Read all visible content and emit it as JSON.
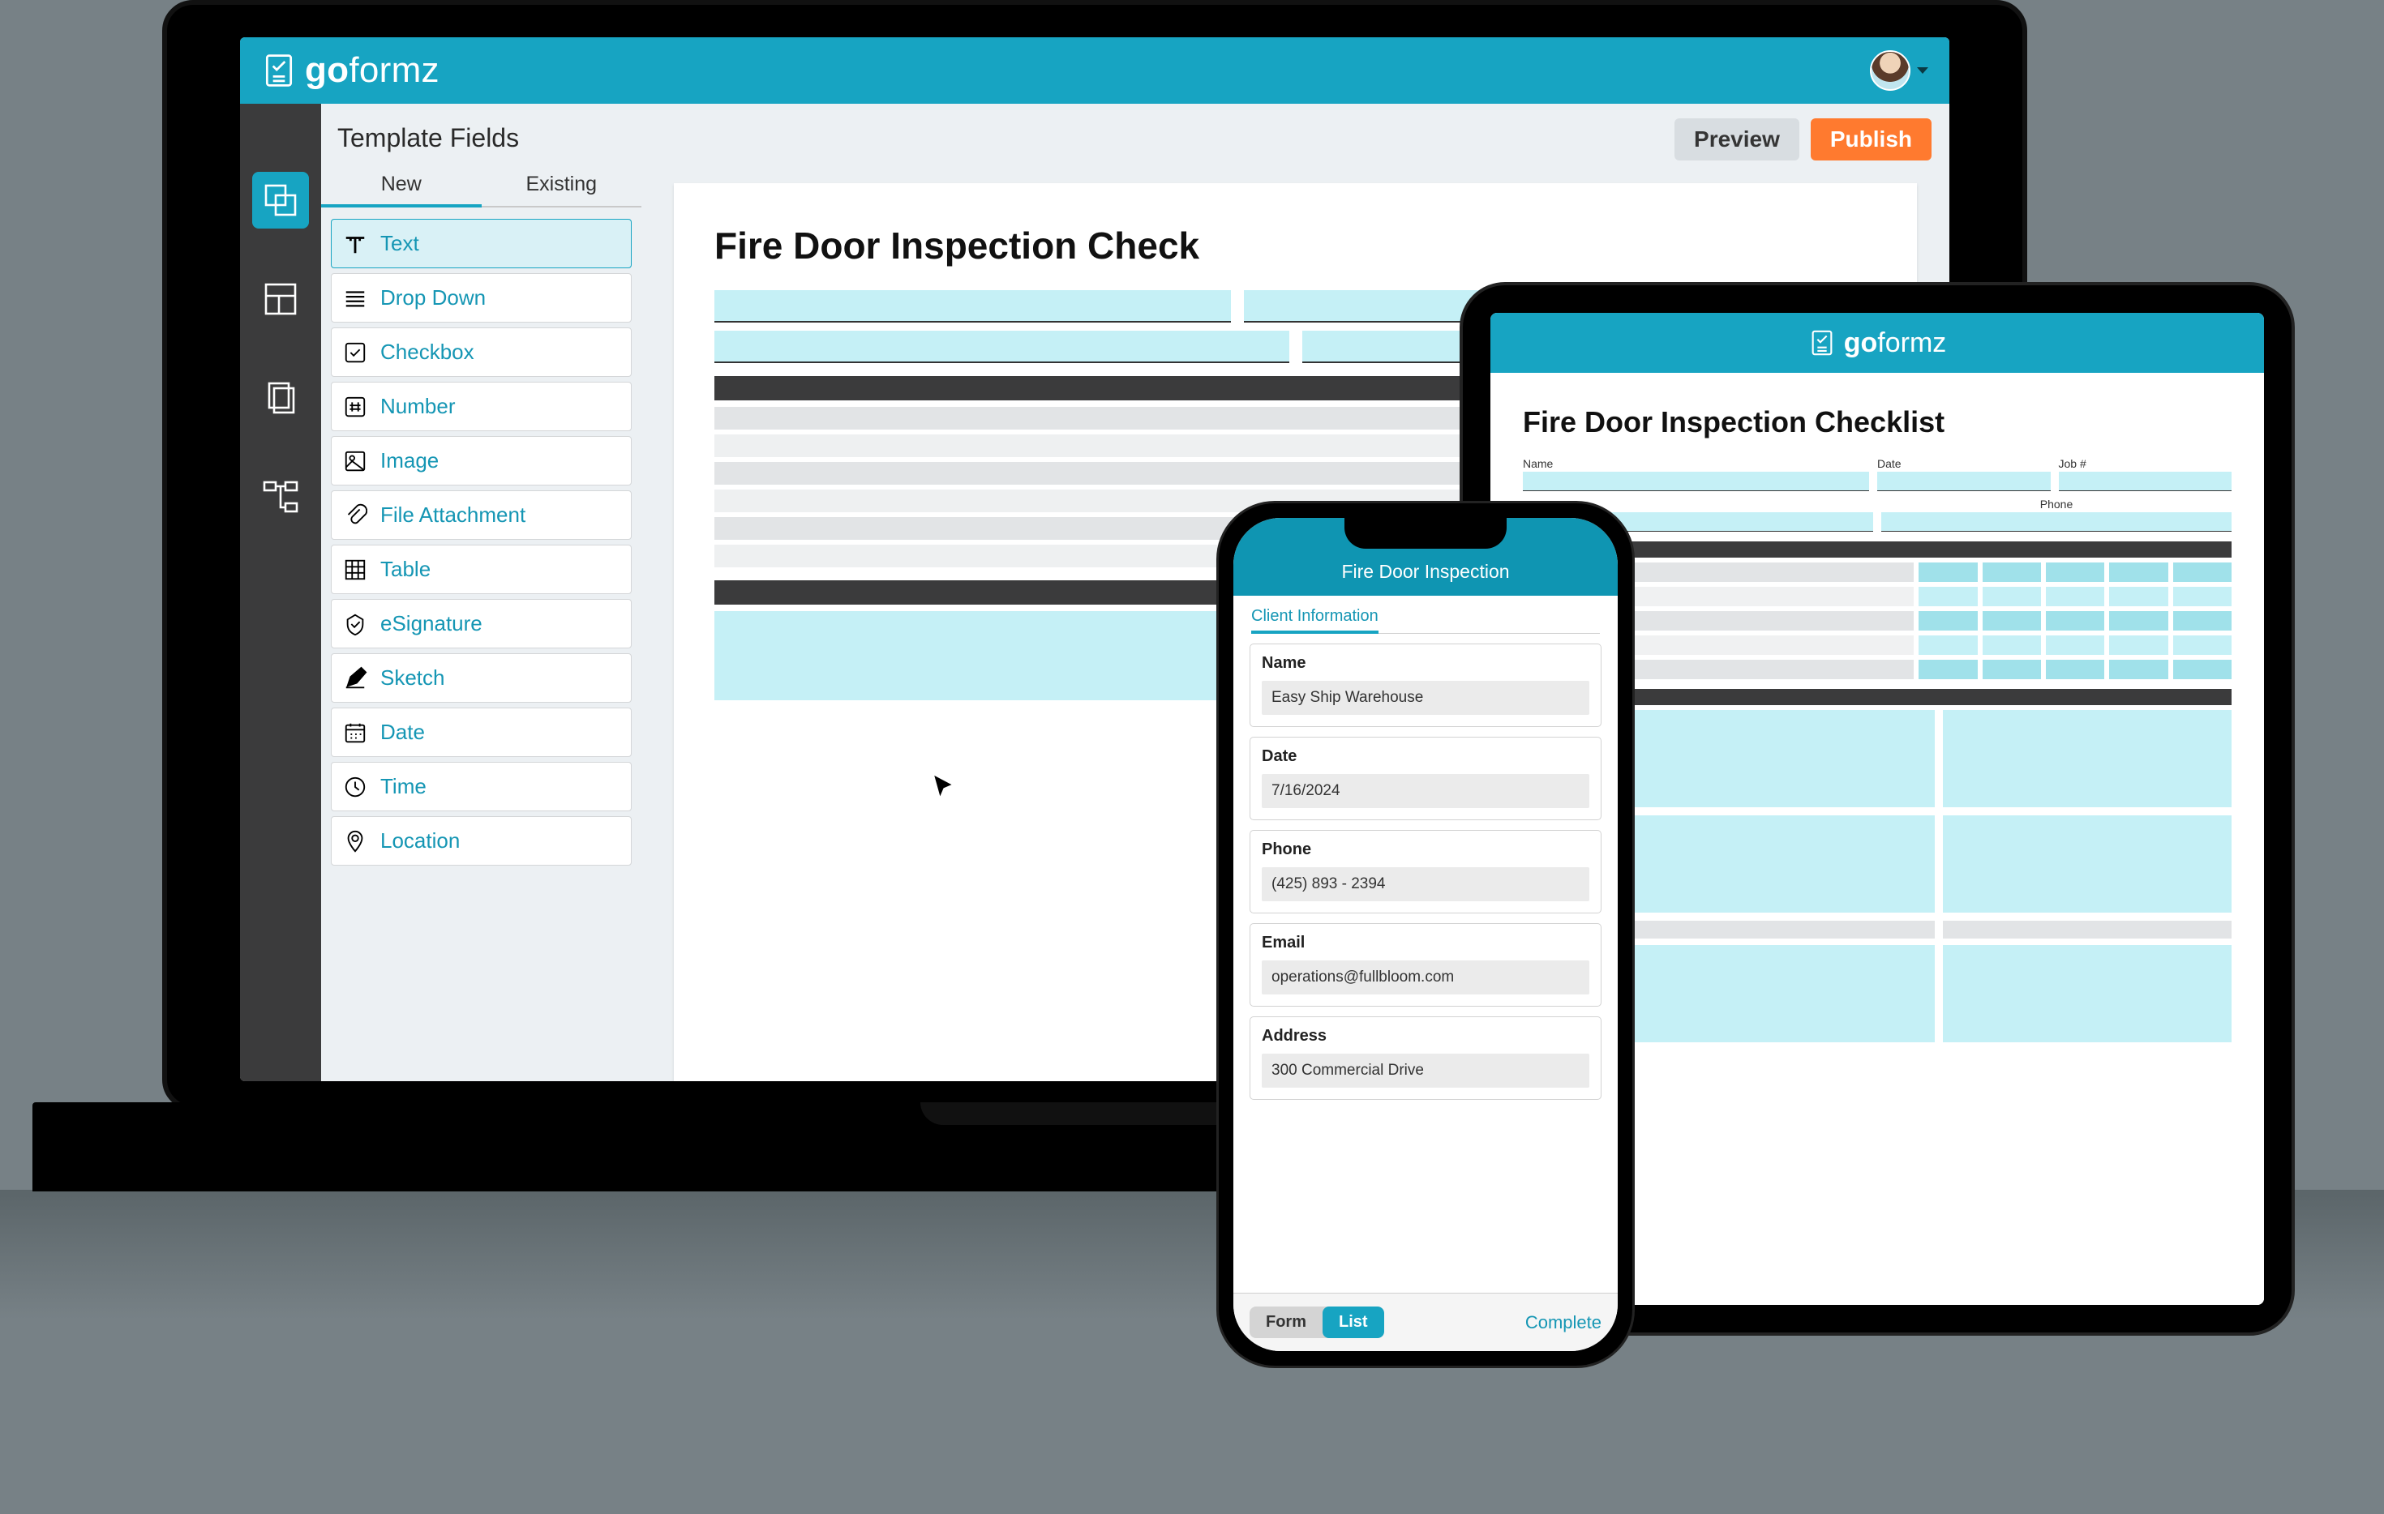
{
  "brand": "goformz",
  "desktop": {
    "panel_title": "Template Fields",
    "tabs": {
      "new": "New",
      "existing": "Existing"
    },
    "fields": {
      "text": "Text",
      "dropdown": "Drop Down",
      "checkbox": "Checkbox",
      "number": "Number",
      "image": "Image",
      "file": "File Attachment",
      "table": "Table",
      "esig": "eSignature",
      "sketch": "Sketch",
      "date": "Date",
      "time": "Time",
      "location": "Location"
    },
    "actions": {
      "preview": "Preview",
      "publish": "Publish"
    },
    "doc_title": "Fire Door Inspection Check"
  },
  "tablet": {
    "doc_title": "Fire Door Inspection Checklist",
    "labels": {
      "name": "Name",
      "date": "Date",
      "job": "Job #",
      "phone": "Phone"
    }
  },
  "phone": {
    "title": "Fire Door Inspection",
    "section": "Client Information",
    "fields": [
      {
        "label": "Name",
        "value": "Easy Ship Warehouse"
      },
      {
        "label": "Date",
        "value": "7/16/2024"
      },
      {
        "label": "Phone",
        "value": "(425) 893 - 2394"
      },
      {
        "label": "Email",
        "value": "operations@fullbloom.com"
      },
      {
        "label": "Address",
        "value": "300 Commercial Drive"
      }
    ],
    "toggle": {
      "form": "Form",
      "list": "List"
    },
    "complete": "Complete"
  }
}
